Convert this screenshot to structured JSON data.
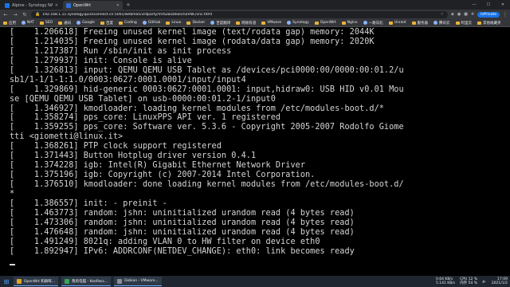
{
  "browser": {
    "tabs": [
      {
        "label": "Alpine - Synology NAS",
        "active": false
      },
      {
        "label": "OpenWrt",
        "active": true
      }
    ],
    "new_tab": "+",
    "url": "192.168.1.11.synology.quickconnect.cn:5001/webman/3rdparty/Virtualization/noVNC/vnc.html",
    "profile_label": "InPrivate",
    "bookmarks": [
      "应用",
      "NAT",
      "SEO",
      "通讯",
      "Google",
      "百度",
      "Coding",
      "GitHub",
      "Linux",
      "Docker",
      "百度翻译",
      "网易有道",
      "VMware",
      "Synology",
      "OpenWrt",
      "Nginx",
      "一路向北",
      "Unraid",
      "服务器",
      "腾讯云",
      "阿里云",
      "其他收藏夹"
    ]
  },
  "console": {
    "lines": [
      "[    1.206618] Freeing unused kernel image (text/rodata gap) memory: 2044K",
      "[    1.214035] Freeing unused kernel image (rodata/data gap) memory: 2020K",
      "[    1.217387] Run /sbin/init as init process",
      "[    1.279937] init: Console is alive",
      "[    1.326813] input: QEMU QEMU USB Tablet as /devices/pci0000:00/0000:00:01.2/u",
      "sb1/1-1/1-1:1.0/0003:0627:0001.0001/input/input4",
      "[    1.329869] hid-generic 0003:0627:0001.0001: input,hidraw0: USB HID v0.01 Mou",
      "se [QEMU QEMU USB Tablet] on usb-0000:00:01.2-1/input0",
      "[    1.346927] kmodloader: loading kernel modules from /etc/modules-boot.d/*",
      "[    1.358274] pps_core: LinuxPPS API ver. 1 registered",
      "[    1.359255] pps_core: Software ver. 5.3.6 - Copyright 2005-2007 Rodolfo Giome",
      "tti <giometti@linux.it>",
      "[    1.368261] PTP clock support registered",
      "[    1.371443] Button Hotplug driver version 0.4.1",
      "[    1.374228] igb: Intel(R) Gigabit Ethernet Network Driver",
      "[    1.375196] igb: Copyright (c) 2007-2014 Intel Corporation.",
      "[    1.376510] kmodloader: done loading kernel modules from /etc/modules-boot.d/",
      "*",
      "[    1.386557] init: - preinit -",
      "[    1.463773] random: jshn: uninitialized urandom read (4 bytes read)",
      "[    1.473306] random: jshn: uninitialized urandom read (4 bytes read)",
      "[    1.476648] random: jshn: uninitialized urandom read (4 bytes read)",
      "[    1.491249] 8021q: adding VLAN 0 to HW filter on device eth0",
      "[    1.892947] IPv6: ADDRCONF(NETDEV_CHANGE): eth0: link becomes ready"
    ]
  },
  "taskbar": {
    "apps": [
      "OpenWrt 和群晖...",
      "我的电脑 - KeePass...",
      "Debian - VMware..."
    ],
    "net_up": "0.64 KB/s",
    "net_down": "5.141 KB/s",
    "cpu": "CPU 12 %",
    "mem": "内存 54 %",
    "time": "17:09",
    "date": "2021/1/2"
  },
  "colors": {
    "console_bg": "#000000",
    "console_fg": "#d6d6d6",
    "chrome_dark": "#202124",
    "accent": "#1a73e8"
  }
}
